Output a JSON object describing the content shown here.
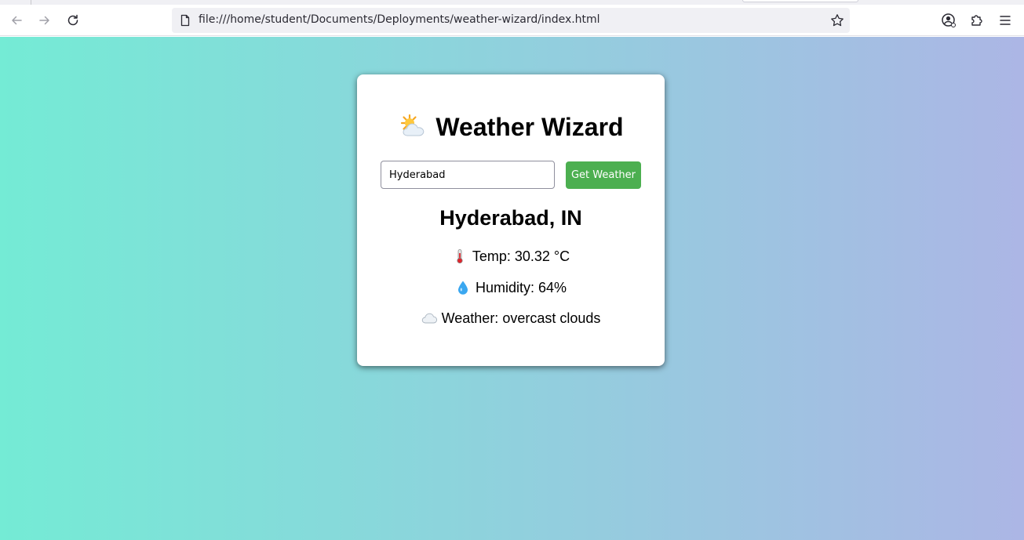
{
  "browser": {
    "url": "file:///home/student/Documents/Deployments/weather-wizard/index.html",
    "icons": {
      "back": "arrow-left-icon",
      "forward": "arrow-right-icon",
      "reload": "reload-icon",
      "page": "page-icon",
      "bookmark": "star-icon",
      "account": "account-icon",
      "extensions": "puzzle-icon",
      "menu": "hamburger-menu-icon"
    }
  },
  "app": {
    "title_icon": "sun-behind-cloud-icon",
    "title": "Weather Wizard",
    "search": {
      "value": "Hyderabad",
      "button_label": "Get Weather"
    },
    "result": {
      "location": "Hyderabad, IN",
      "temp_icon": "thermometer-icon",
      "temp_text": "Temp: 30.32 °C",
      "humidity_icon": "droplet-icon",
      "humidity_text": "Humidity: 64%",
      "weather_icon": "cloud-icon",
      "weather_text": "Weather: overcast clouds"
    }
  },
  "colors": {
    "gradient_start": "#74ebd5",
    "gradient_end": "#acb6e5",
    "button": "#4caf50",
    "card": "#ffffff"
  }
}
